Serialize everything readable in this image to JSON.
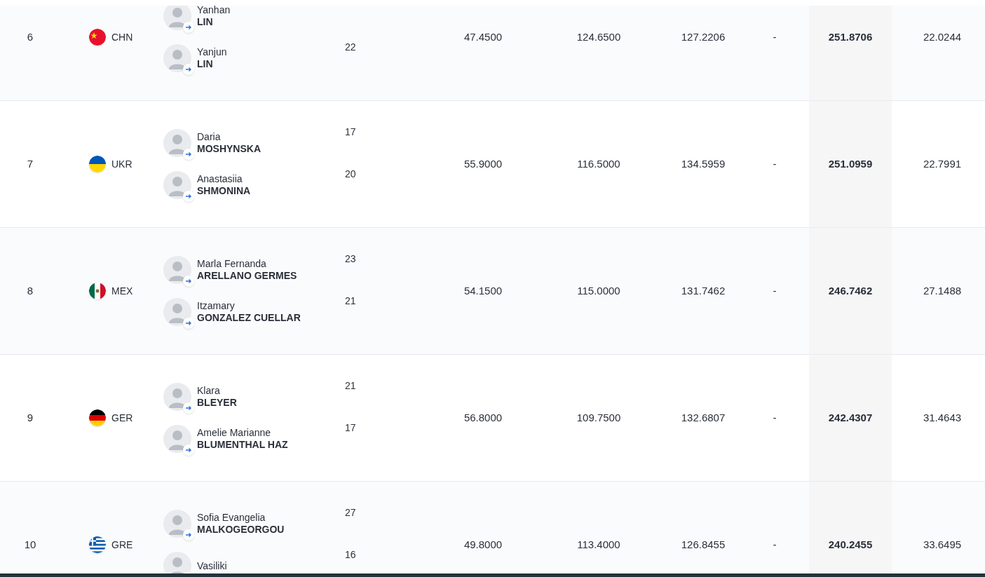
{
  "rows": [
    {
      "rank": "6",
      "flag": {
        "kind": "chn"
      },
      "noc": "CHN",
      "athletes": [
        {
          "first": "Yanhan",
          "last": "LIN"
        },
        {
          "first": "Yanjun",
          "last": "LIN",
          "age": "22"
        }
      ],
      "scores": [
        "47.4500",
        "124.6500",
        "127.2206",
        "-"
      ],
      "total": "251.8706",
      "behind": "22.0244"
    },
    {
      "rank": "7",
      "flag": {
        "kind": "ukr"
      },
      "noc": "UKR",
      "athletes": [
        {
          "first": "Daria",
          "last": "MOSHYNSKA",
          "age": "17"
        },
        {
          "first": "Anastasiia",
          "last": "SHMONINA",
          "age": "20"
        }
      ],
      "scores": [
        "55.9000",
        "116.5000",
        "134.5959",
        "-"
      ],
      "total": "251.0959",
      "behind": "22.7991"
    },
    {
      "rank": "8",
      "flag": {
        "kind": "mex"
      },
      "noc": "MEX",
      "athletes": [
        {
          "first": "Marla Fernanda",
          "last": "ARELLANO GERMES",
          "age": "23"
        },
        {
          "first": "Itzamary",
          "last": "GONZALEZ CUELLAR",
          "age": "21"
        }
      ],
      "scores": [
        "54.1500",
        "115.0000",
        "131.7462",
        "-"
      ],
      "total": "246.7462",
      "behind": "27.1488"
    },
    {
      "rank": "9",
      "flag": {
        "kind": "ger"
      },
      "noc": "GER",
      "athletes": [
        {
          "first": "Klara",
          "last": "BLEYER",
          "age": "21"
        },
        {
          "first": "Amelie Marianne",
          "last": "BLUMENTHAL HAZ",
          "age": "17"
        }
      ],
      "scores": [
        "56.8000",
        "109.7500",
        "132.6807",
        "-"
      ],
      "total": "242.4307",
      "behind": "31.4643"
    },
    {
      "rank": "10",
      "flag": {
        "kind": "gre"
      },
      "noc": "GRE",
      "athletes": [
        {
          "first": "Sofia Evangelia",
          "last": "MALKOGEORGOU",
          "age": "27"
        },
        {
          "first": "Vasiliki",
          "age": "16"
        }
      ],
      "scores": [
        "49.8000",
        "113.4000",
        "126.8455",
        "-"
      ],
      "total": "240.2455",
      "behind": "33.6495"
    }
  ]
}
